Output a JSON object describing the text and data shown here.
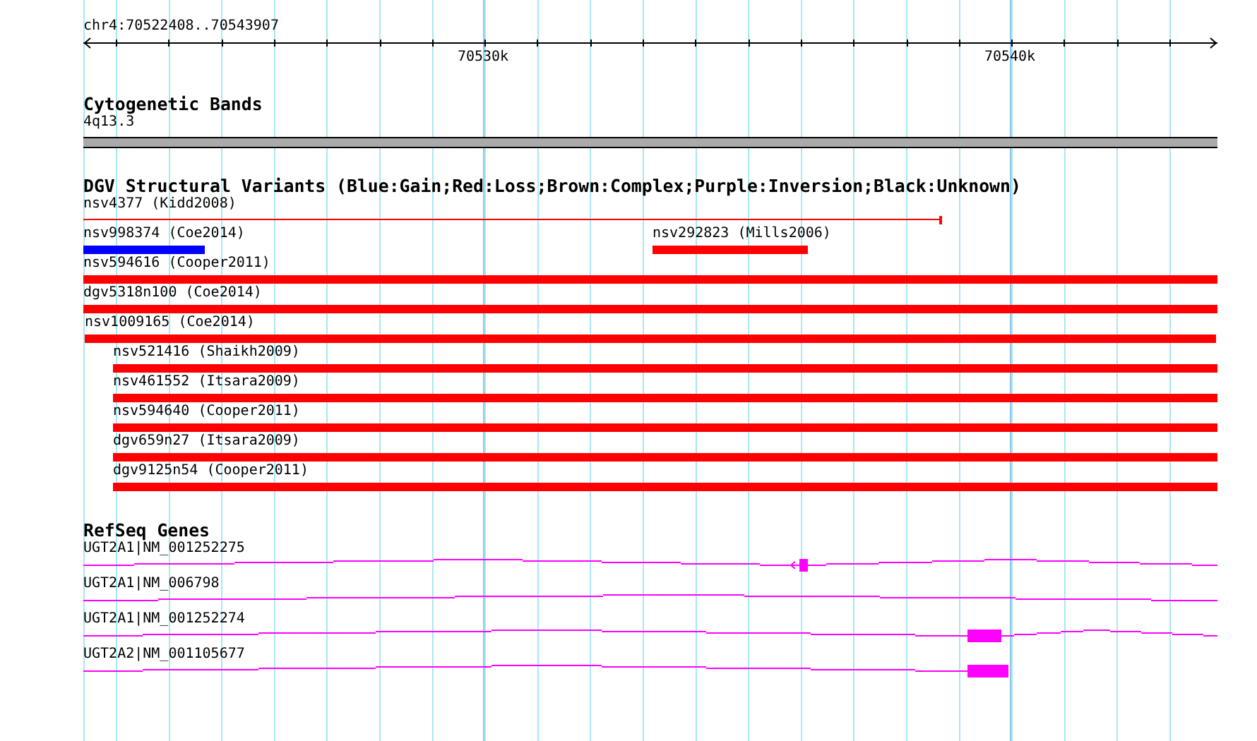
{
  "ruler": {
    "region": "chr4:70522408..70543907",
    "ticks": [
      "70530k",
      "70540k"
    ]
  },
  "cytoband_track": {
    "title": "Cytogenetic Bands",
    "band": "4q13.3"
  },
  "variant_track": {
    "title": "DGV Structural Variants (Blue:Gain;Red:Loss;Brown:Complex;Purple:Inversion;Black:Unknown)",
    "rows": [
      {
        "features": [
          {
            "label": "nsv4377 (Kidd2008)",
            "kind": "line",
            "color": "#ff0000"
          }
        ]
      },
      {
        "features": [
          {
            "label": "nsv998374 (Coe2014)",
            "kind": "bar",
            "color": "#0000ff"
          },
          {
            "label": "nsv292823 (Mills2006)",
            "kind": "bar",
            "color": "#ff0000"
          }
        ]
      },
      {
        "features": [
          {
            "label": "nsv594616 (Cooper2011)",
            "kind": "bar",
            "color": "#ff0000"
          }
        ]
      },
      {
        "features": [
          {
            "label": "dgv5318n100 (Coe2014)",
            "kind": "bar",
            "color": "#ff0000"
          }
        ]
      },
      {
        "features": [
          {
            "label": "nsv1009165 (Coe2014)",
            "kind": "bar",
            "color": "#ff0000"
          }
        ]
      },
      {
        "features": [
          {
            "label": "nsv521416 (Shaikh2009)",
            "kind": "bar",
            "color": "#ff0000"
          }
        ]
      },
      {
        "features": [
          {
            "label": "nsv461552 (Itsara2009)",
            "kind": "bar",
            "color": "#ff0000"
          }
        ]
      },
      {
        "features": [
          {
            "label": "nsv594640 (Cooper2011)",
            "kind": "bar",
            "color": "#ff0000"
          }
        ]
      },
      {
        "features": [
          {
            "label": "dgv659n27 (Itsara2009)",
            "kind": "bar",
            "color": "#ff0000"
          }
        ]
      },
      {
        "features": [
          {
            "label": "dgv9125n54 (Cooper2011)",
            "kind": "bar",
            "color": "#ff0000"
          }
        ]
      }
    ]
  },
  "gene_track": {
    "title": "RefSeq Genes",
    "genes": [
      {
        "label": "UGT2A1|NM_001252275"
      },
      {
        "label": "UGT2A1|NM_006798"
      },
      {
        "label": "UGT2A1|NM_001252274"
      },
      {
        "label": "UGT2A2|NM_001105677"
      }
    ]
  }
}
